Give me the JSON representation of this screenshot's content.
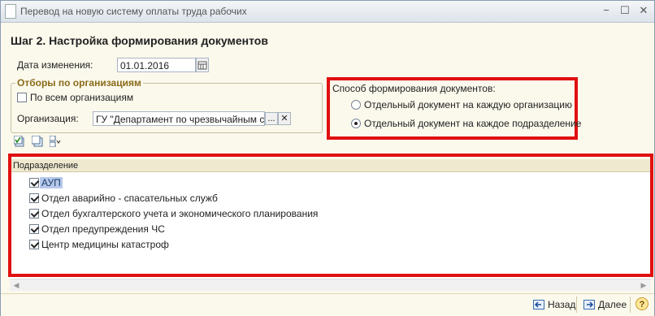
{
  "window": {
    "title": "Перевод на новую систему оплаты труда рабочих"
  },
  "step_title": "Шаг 2. Настройка формирования документов",
  "change_date": {
    "label": "Дата изменения:",
    "value": "01.01.2016"
  },
  "org_filter": {
    "title": "Отборы по организациям",
    "all_orgs_label": "По всем организациям",
    "org_label": "Организация:",
    "org_value": "ГУ \"Департамент по чрезвычайным ситу",
    "more_button": "...",
    "clear_button": "✕"
  },
  "doc_method": {
    "title": "Способ формирования документов:",
    "options": [
      {
        "label": "Отдельный документ на каждую организацию",
        "selected": false
      },
      {
        "label": "Отдельный документ на каждое подразделение",
        "selected": true
      }
    ]
  },
  "list": {
    "header": "Подразделение",
    "rows": [
      {
        "label": "АУП",
        "checked": true,
        "selected": true
      },
      {
        "label": "Отдел аварийно - спасательных служб",
        "checked": true,
        "selected": false
      },
      {
        "label": "Отдел бухгалтерского учета и экономического планирования",
        "checked": true,
        "selected": false
      },
      {
        "label": "Отдел предупреждения ЧС",
        "checked": true,
        "selected": false
      },
      {
        "label": "Центр медицины катастроф",
        "checked": true,
        "selected": false
      }
    ]
  },
  "footer": {
    "back": "Назад",
    "next": "Далее",
    "help": "?"
  },
  "colors": {
    "highlight_frame": "#e01010",
    "background": "#fbf9ec",
    "selection": "#b6c9ea"
  }
}
